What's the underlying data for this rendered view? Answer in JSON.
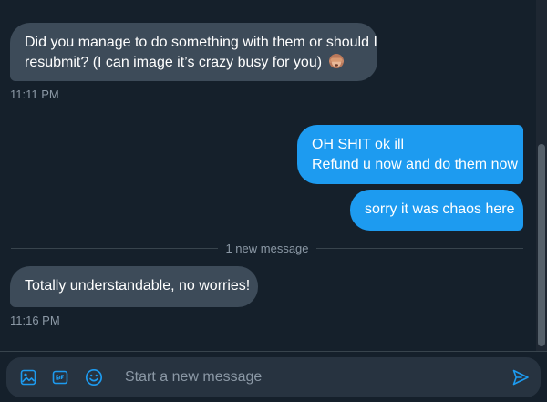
{
  "messages": {
    "m1": {
      "line1": "Did you manage to do something with them or should I",
      "line2": "resubmit? (I can image it’s crazy busy for you)",
      "emoji": "see-no-evil-monkey",
      "time": "11:11 PM"
    },
    "m2": {
      "line1": "OH SHIT ok ill",
      "line2": "Refund u now and do them now"
    },
    "m3": {
      "text": "sorry it was chaos here"
    },
    "divider": "1 new message",
    "m4": {
      "text": "Totally understandable, no worries!",
      "time": "11:16 PM"
    }
  },
  "composer": {
    "placeholder": "Start a new message",
    "icons": [
      "image-icon",
      "gif-icon",
      "emoji-icon",
      "send-icon"
    ]
  },
  "colors": {
    "background": "#15202b",
    "incoming_bubble": "#3d4b59",
    "outgoing_bubble": "#1d9bf0",
    "accent": "#1d9bf0",
    "muted_text": "#8b98a5"
  }
}
